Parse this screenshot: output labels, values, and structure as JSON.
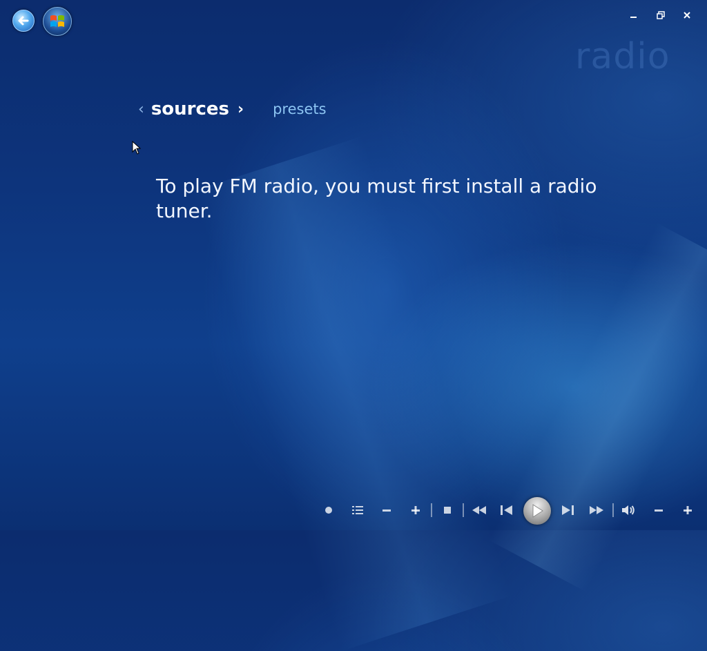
{
  "watermark": "radio",
  "pivot": {
    "active": "sources",
    "inactive": "presets"
  },
  "message": "To play FM radio, you must first install a radio tuner.",
  "transport": {
    "buttons": [
      {
        "name": "record-icon"
      },
      {
        "name": "guide-icon"
      },
      {
        "name": "channel-down-icon"
      },
      {
        "name": "channel-up-icon"
      },
      {
        "name": "stop-icon"
      },
      {
        "name": "rewind-icon"
      },
      {
        "name": "skip-back-icon"
      },
      {
        "name": "play-icon"
      },
      {
        "name": "skip-forward-icon"
      },
      {
        "name": "fast-forward-icon"
      },
      {
        "name": "mute-icon"
      },
      {
        "name": "volume-down-icon"
      },
      {
        "name": "volume-up-icon"
      }
    ]
  },
  "colors": {
    "background": "#0d347c",
    "accent": "#8cc4f2"
  }
}
